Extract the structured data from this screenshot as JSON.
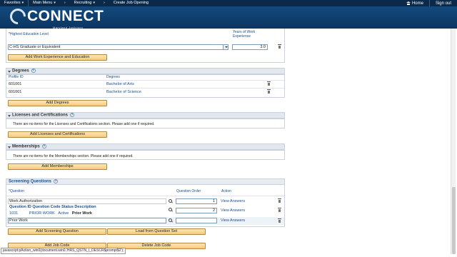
{
  "topnav": {
    "favorites": "Favorites",
    "main_menu": "Main Menu",
    "recruiting": "Recruiting",
    "create_job_opening": "Create Job Opening",
    "home": "Home",
    "sign_out": "Sign out"
  },
  "banner": {
    "logo_text": "CONNECT",
    "logo_sub": "Maryland Judiciary"
  },
  "education": {
    "level_label": "*Highest Education Level",
    "years_label": "Years of Work Experience",
    "level_value": "C-HS Graduate or Equivalent",
    "years_value": "3.0",
    "add_button": "Add Work Experience and Education"
  },
  "degrees": {
    "title": "Degrees",
    "col_profile": "Profile ID",
    "col_degrees": "Degrees",
    "rows": [
      {
        "profile_id": "601001",
        "degree": "Bachelor of Arts"
      },
      {
        "profile_id": "601001",
        "degree": "Bachelor of Science"
      }
    ],
    "add_button": "Add Degrees"
  },
  "licenses": {
    "title": "Licenses and Certifications",
    "empty_text": "There are no items for the Licenses and Certifications section.  Please add one if required.",
    "add_button": "Add Licenses and Certifications"
  },
  "memberships": {
    "title": "Memberships",
    "empty_text": "There are no items for the Memberships section.  Please add one if required.",
    "add_button": "Add Memberships"
  },
  "screening": {
    "title": "Screening Questions",
    "col_question": "*Question",
    "col_order": "Question Order",
    "col_action": "Action",
    "rows": [
      {
        "question": "Work Authorization",
        "order": "1",
        "action": "View Answers"
      },
      {
        "question": "",
        "order": "2",
        "action": "View Answers"
      },
      {
        "question": "Prior Work",
        "order": "",
        "action": "View Answers"
      }
    ],
    "tooltip": {
      "h_id": "Question ID",
      "h_code": "Question Code",
      "h_status": "Status",
      "h_desc": "Description",
      "id": "1031",
      "code": "PRIOR WORK",
      "status": "Active",
      "desc": "Prior Work"
    },
    "add_button": "Add Screening Question",
    "load_button": "Load from Question Set"
  },
  "bottom": {
    "add_job_code": "Add Job Code",
    "delete_job_code": "Delete Job Code"
  },
  "statusbar": {
    "text": "javascript:pAction_win0(document.win0,'HRS_QSTN_I_DESCR$prompt$2');"
  }
}
